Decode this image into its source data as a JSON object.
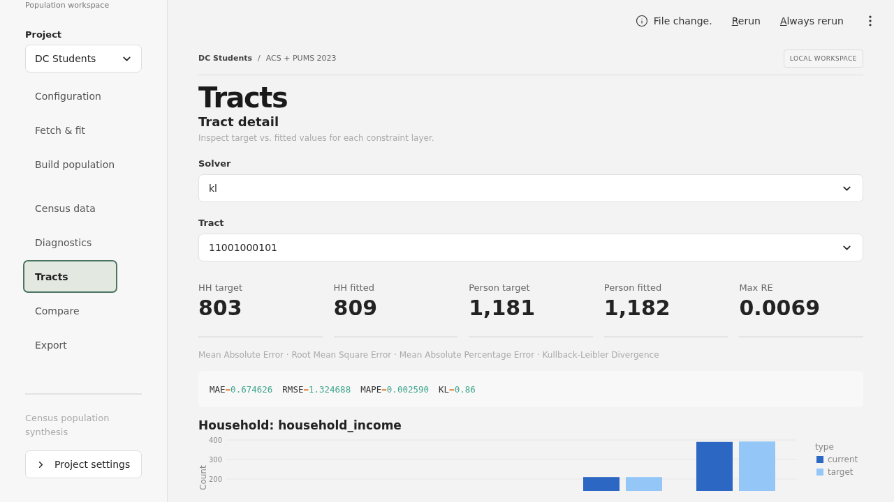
{
  "sidebar": {
    "caption": "Population workspace",
    "project_label": "Project",
    "project": "DC Students",
    "nav_groups": [
      [
        {
          "label": "Configuration",
          "selected": false
        },
        {
          "label": "Fetch & fit",
          "selected": false
        },
        {
          "label": "Build population",
          "selected": false
        }
      ],
      [
        {
          "label": "Census data",
          "selected": false
        },
        {
          "label": "Diagnostics",
          "selected": false
        },
        {
          "label": "Tracts",
          "selected": true
        },
        {
          "label": "Compare",
          "selected": false
        },
        {
          "label": "Export",
          "selected": false
        }
      ]
    ],
    "footer_text": "Census population synthesis",
    "settings_button": "Project settings"
  },
  "toolbar": {
    "status": "File change.",
    "actions": [
      "Rerun",
      "Always rerun"
    ]
  },
  "breadcrumb": [
    "DC Students",
    "ACS + PUMS 2023"
  ],
  "breadcrumb_separator": "/",
  "badge": "LOCAL WORKSPACE",
  "title": "Tracts",
  "subtitle": "Tract detail",
  "description": "Inspect target vs. fitted values for each constraint layer.",
  "selects": [
    {
      "label": "Solver",
      "value": "kl"
    },
    {
      "label": "Tract",
      "value": "11001000101"
    }
  ],
  "stats": [
    {
      "label": "HH target",
      "value": "803"
    },
    {
      "label": "HH fitted",
      "value": "809"
    },
    {
      "label": "Person target",
      "value": "1,181"
    },
    {
      "label": "Person fitted",
      "value": "1,182"
    },
    {
      "label": "Max RE",
      "value": "0.0069"
    }
  ],
  "metrics_caption": "Mean Absolute Error · Root Mean Square Error · Mean Absolute Percentage Error · Kullback-Leibler Divergence",
  "metrics": [
    {
      "name": "MAE",
      "value": "0.674626"
    },
    {
      "name": "RMSE",
      "value": "1.324688"
    },
    {
      "name": "MAPE",
      "value": "0.002590"
    },
    {
      "name": "KL",
      "value": "0.86"
    }
  ],
  "metrics_equals": "=",
  "chart_title": "Household: household_income",
  "chart_data": {
    "type": "bar",
    "ylabel": "Count",
    "ylim": [
      0,
      400
    ],
    "grid": true,
    "legend": "right",
    "yticks": [
      200,
      300,
      400
    ],
    "stacked": false,
    "legend_title": "type",
    "series": [
      {
        "name": "current",
        "color": "#2c67c4",
        "values": [
          null,
          null,
          null,
          210,
          390
        ]
      },
      {
        "name": "target",
        "color": "#94c6f7",
        "values": [
          null,
          null,
          null,
          210,
          392
        ]
      }
    ]
  }
}
